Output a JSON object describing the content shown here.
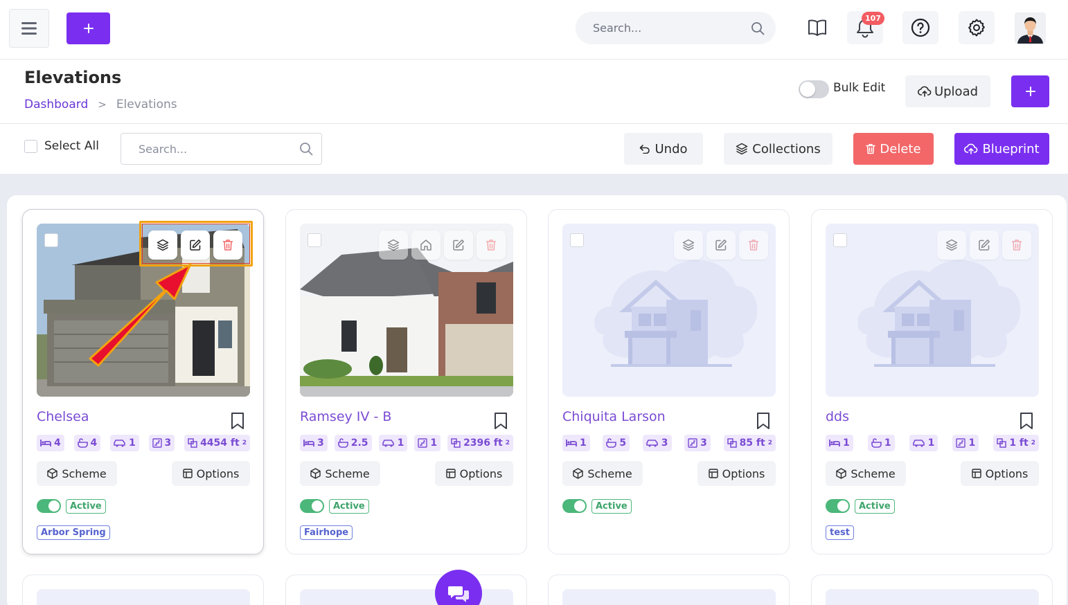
{
  "topbar": {
    "search_placeholder": "Search...",
    "notification_count": "107",
    "icons": [
      "hamburger-menu-icon",
      "plus-icon",
      "search-icon",
      "book-icon",
      "bell-icon",
      "help-icon",
      "gear-icon"
    ]
  },
  "header": {
    "title": "Elevations",
    "breadcrumb": {
      "home": "Dashboard",
      "separator": ">",
      "current": "Elevations"
    },
    "bulk_edit_label": "Bulk Edit",
    "bulk_edit_on": false,
    "upload_label": "Upload",
    "add_label": "+"
  },
  "toolbar": {
    "select_all_label": "Select All",
    "search_placeholder": "Search...",
    "undo_label": "Undo",
    "collections_label": "Collections",
    "delete_label": "Delete",
    "blueprint_label": "Blueprint"
  },
  "cards": [
    {
      "name": "Chelsea",
      "image": "house-photo",
      "actions": [
        "layers-icon",
        "edit-icon",
        "trash-icon"
      ],
      "stats": {
        "beds": "4",
        "baths": "4",
        "garage": "1",
        "stories": "3",
        "area": "4454 ft"
      },
      "scheme_label": "Scheme",
      "options_label": "Options",
      "status": "Active",
      "tag": "Arbor Spring"
    },
    {
      "name": "Ramsey IV - B",
      "image": "house-photo",
      "actions": [
        "layers-icon",
        "home-icon",
        "edit-icon",
        "trash-icon"
      ],
      "stats": {
        "beds": "3",
        "baths": "2.5",
        "garage": "1",
        "stories": "1",
        "area": "2396 ft"
      },
      "scheme_label": "Scheme",
      "options_label": "Options",
      "status": "Active",
      "tag": "Fairhope"
    },
    {
      "name": "Chiquita Larson",
      "image": "placeholder-house",
      "actions": [
        "layers-icon",
        "edit-icon",
        "trash-icon"
      ],
      "stats": {
        "beds": "1",
        "baths": "5",
        "garage": "3",
        "stories": "3",
        "area": "85 ft"
      },
      "scheme_label": "Scheme",
      "options_label": "Options",
      "status": "Active",
      "tag": ""
    },
    {
      "name": "dds",
      "image": "placeholder-house",
      "actions": [
        "layers-icon",
        "edit-icon",
        "trash-icon"
      ],
      "stats": {
        "beds": "1",
        "baths": "1",
        "garage": "1",
        "stories": "1",
        "area": "1 ft"
      },
      "scheme_label": "Scheme",
      "options_label": "Options",
      "status": "Active",
      "tag": "test"
    }
  ],
  "area_superscript": "2",
  "colors": {
    "primary": "#7a2ff0",
    "accent_text": "#7a4bd3",
    "danger": "#f36769",
    "success": "#4bb77a",
    "tag_blue": "#5663cf",
    "highlight": "#f2a30f",
    "arrow": "#e8102e"
  }
}
